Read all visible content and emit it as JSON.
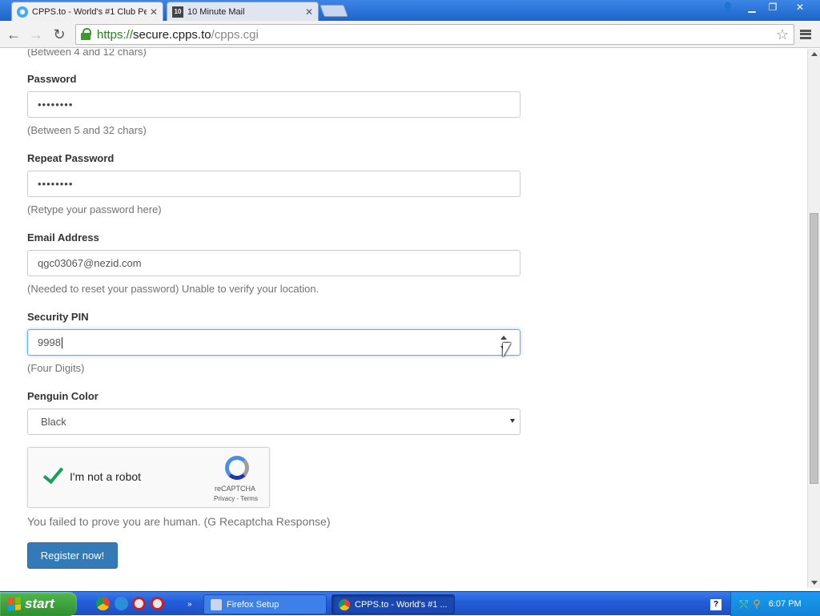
{
  "browser": {
    "tabs": [
      {
        "title": "CPPS.to - World's #1 Club Pe",
        "active": true
      },
      {
        "title": "10 Minute Mail",
        "active": false
      }
    ],
    "tab2_favicon": "10",
    "url": {
      "scheme": "https://",
      "host": "secure.cpps.to",
      "path": "/cpps.cgi"
    }
  },
  "form": {
    "username_hint": "(Between 4 and 12 chars)",
    "password_label": "Password",
    "password_value": "••••••••",
    "password_hint": "(Between 5 and 32 chars)",
    "repeat_label": "Repeat Password",
    "repeat_value": "••••••••",
    "repeat_hint": "(Retype your password here)",
    "email_label": "Email Address",
    "email_value": "qgc03067@nezid.com",
    "email_hint": "(Needed to reset your password) Unable to verify your location.",
    "pin_label": "Security PIN",
    "pin_value": "9998",
    "pin_hint": "(Four Digits)",
    "color_label": "Penguin Color",
    "color_value": "Black",
    "captcha_label": "I'm not a robot",
    "captcha_brand": "reCAPTCHA",
    "captcha_links": "Privacy - Terms",
    "captcha_error": "You failed to prove you are human. (G Recaptcha Response)",
    "submit_label": "Register now!"
  },
  "taskbar": {
    "start_label": "start",
    "items": [
      {
        "label": "Firefox Setup"
      },
      {
        "label": "CPPS.to - World's #1 ..."
      }
    ],
    "clock": "6:07 PM"
  }
}
